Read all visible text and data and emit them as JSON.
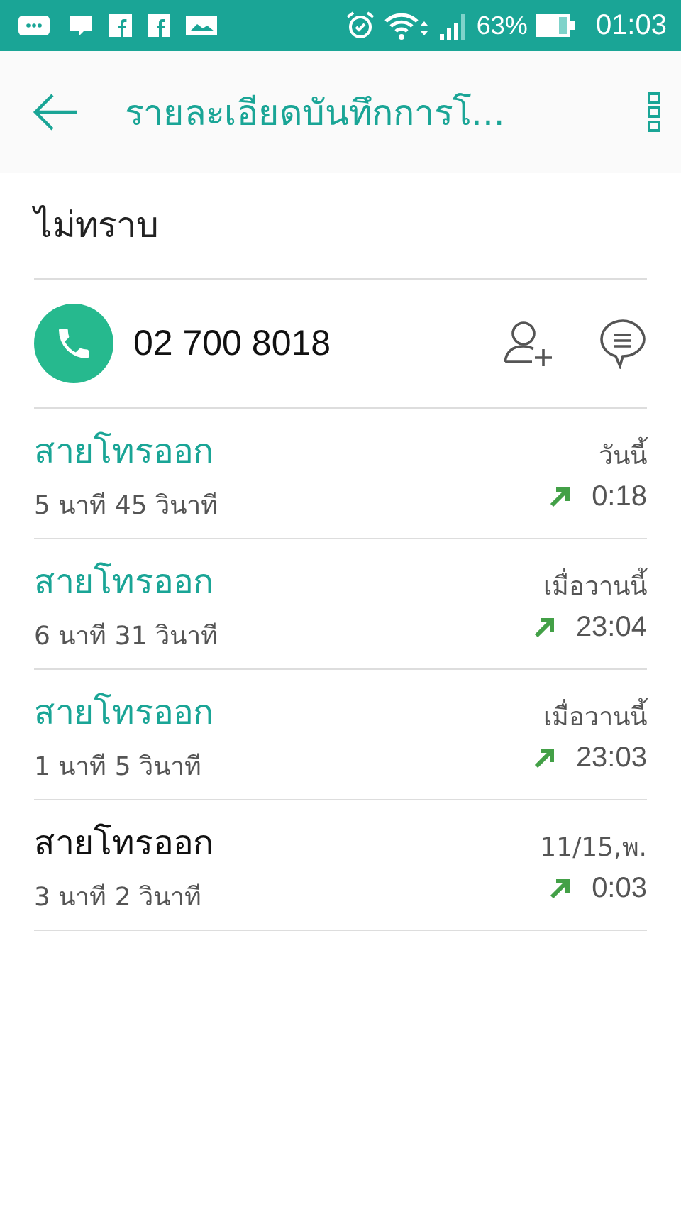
{
  "status_bar": {
    "battery": "63%",
    "time": "01:03"
  },
  "app_bar": {
    "title": "รายละเอียดบันทึกการโ..."
  },
  "contact": {
    "name": "ไม่ทราบ",
    "number": "02 700 8018"
  },
  "calls": [
    {
      "type": "สายโทรออก",
      "duration": "5 นาที 45 วินาที",
      "date": "วันนี้",
      "time": "0:18",
      "highlighted": true
    },
    {
      "type": "สายโทรออก",
      "duration": "6 นาที 31 วินาที",
      "date": "เมื่อวานนี้",
      "time": "23:04",
      "highlighted": true
    },
    {
      "type": "สายโทรออก",
      "duration": "1 นาที 5 วินาที",
      "date": "เมื่อวานนี้",
      "time": "23:03",
      "highlighted": true
    },
    {
      "type": "สายโทรออก",
      "duration": "3 นาที 2 วินาที",
      "date": "11/15,พ.",
      "time": "0:03",
      "highlighted": false
    }
  ]
}
